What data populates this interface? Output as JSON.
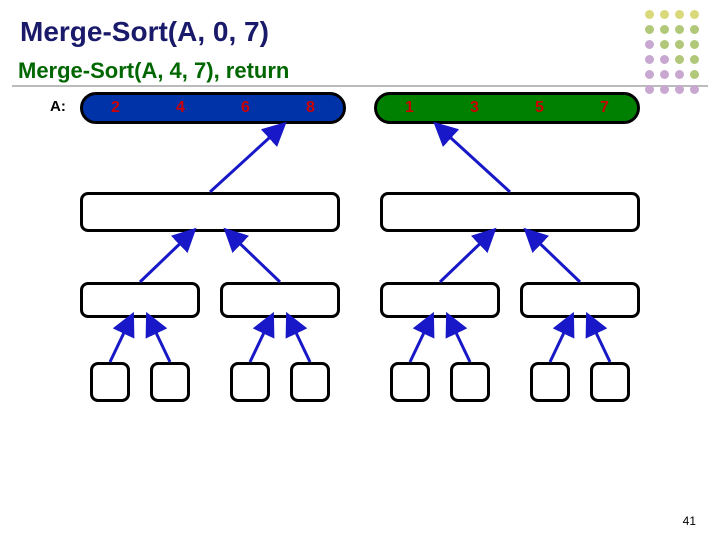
{
  "title": "Merge-Sort(A, 0, 7)",
  "subtitle": "Merge-Sort(A, 4, 7), return",
  "array_label": "A:",
  "array": {
    "left_half": [
      "2",
      "4",
      "6",
      "8"
    ],
    "right_half": [
      "1",
      "3",
      "5",
      "7"
    ],
    "right_sorted": true
  },
  "levels": {
    "level1_count": 2,
    "level2_count": 4,
    "level3_count": 8
  },
  "page_number": "41",
  "dot_colors": [
    "#d9d97a",
    "#d9d97a",
    "#d9d97a",
    "#d9d97a",
    "#b0c878",
    "#b0c878",
    "#b0c878",
    "#b0c878",
    "#c8a8d0",
    "#b0c878",
    "#b0c878",
    "#b0c878",
    "#c8a8d0",
    "#c8a8d0",
    "#b0c878",
    "#b0c878",
    "#c8a8d0",
    "#c8a8d0",
    "#c8a8d0",
    "#b0c878",
    "#c8a8d0",
    "#c8a8d0",
    "#c8a8d0",
    "#c8a8d0"
  ]
}
